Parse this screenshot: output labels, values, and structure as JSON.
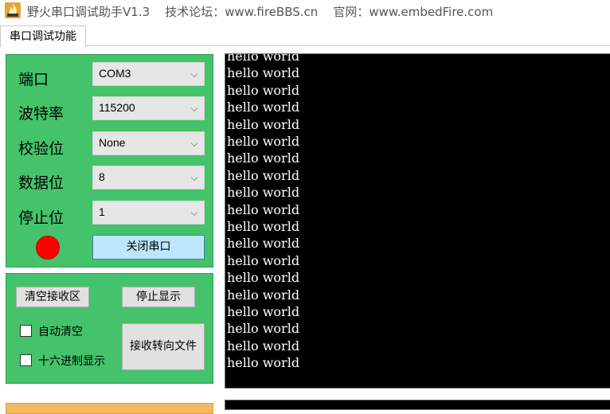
{
  "window": {
    "title": "野火串口调试助手V1.3    技术论坛：www.fireBBS.cn    官网：www.embedFire.com",
    "icon": "flame-app-icon"
  },
  "tabs": [
    {
      "label": "串口调试功能",
      "active": true
    }
  ],
  "serial_settings": {
    "port": {
      "label": "端口",
      "value": "COM3"
    },
    "baud_rate": {
      "label": "波特率",
      "value": "115200"
    },
    "parity": {
      "label": "校验位",
      "value": "None"
    },
    "data_bits": {
      "label": "数据位",
      "value": "8"
    },
    "stop_bits": {
      "label": "停止位",
      "value": "1"
    },
    "status_color": "#ff0000",
    "close_port_label": "关闭串口"
  },
  "receive_controls": {
    "clear_label": "清空接收区",
    "stop_display_label": "停止显示",
    "auto_clear_label": "自动清空",
    "auto_clear_checked": false,
    "hex_display_label": "十六进制显示",
    "hex_display_checked": false,
    "save_to_file_label": "接收转向文件"
  },
  "receive_area": {
    "lines": [
      "hello world",
      "hello world",
      "hello world",
      "hello world",
      "hello world",
      "hello world",
      "hello world",
      "hello world",
      "hello world",
      "hello world",
      "hello world",
      "hello world",
      "hello world",
      "hello world",
      "hello world",
      "hello world",
      "hello world",
      "hello world",
      "hello world"
    ]
  },
  "colors": {
    "panel_green": "#44c36a",
    "console_bg": "#000000",
    "console_text": "#ffffff",
    "send_panel_orange": "#f5b960"
  }
}
